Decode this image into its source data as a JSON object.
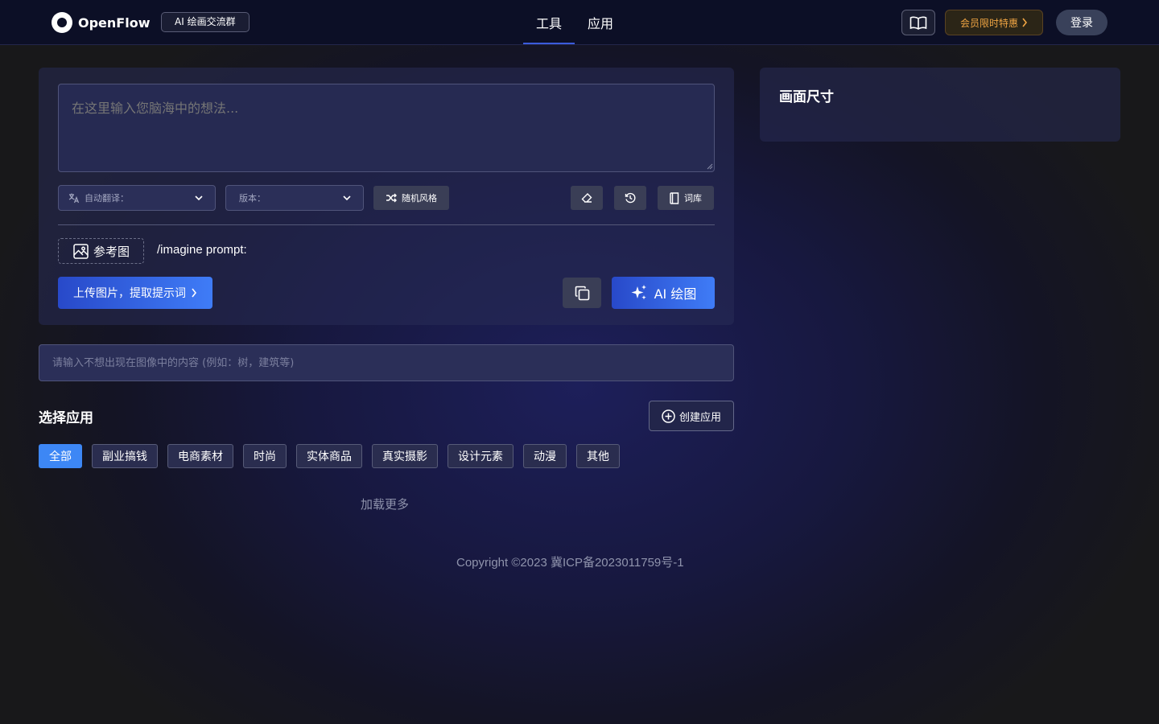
{
  "header": {
    "app_name": "OpenFlow",
    "group_badge": "AI 绘画交流群",
    "nav": [
      {
        "label": "工具",
        "active": true
      },
      {
        "label": "应用",
        "active": false
      }
    ],
    "vip_label": "会员限时特惠",
    "login_label": "登录",
    "icons": {
      "book": "book-open-icon",
      "chevron": "chevron-right-icon"
    }
  },
  "prompt": {
    "placeholder": "在这里输入您脑海中的想法...",
    "value": "",
    "translate_label": "自动翻译：",
    "version_label": "版本：",
    "random_label": "随机风格",
    "lexicon_label": "词库",
    "reference_label": "参考图",
    "imagine_text": "/imagine prompt:",
    "upload_label": "上传图片，提取提示词",
    "ai_draw_label": "AI 绘图"
  },
  "size_panel": {
    "title": "画面尺寸"
  },
  "negative": {
    "placeholder": "请输入不想出现在图像中的内容 (例如：树，建筑等)",
    "value": ""
  },
  "apps": {
    "title": "选择应用",
    "create_label": "创建应用",
    "categories": [
      "全部",
      "副业搞钱",
      "电商素材",
      "时尚",
      "实体商品",
      "真实摄影",
      "设计元素",
      "动漫",
      "其他"
    ],
    "active_category": "全部",
    "load_more": "加载更多"
  },
  "footer": {
    "copyright": "Copyright ©2023  冀ICP备2023011759号-1"
  },
  "colors": {
    "accent": "#3d87f5",
    "vip": "#f0a543",
    "header_bg": "#0c0f26"
  }
}
